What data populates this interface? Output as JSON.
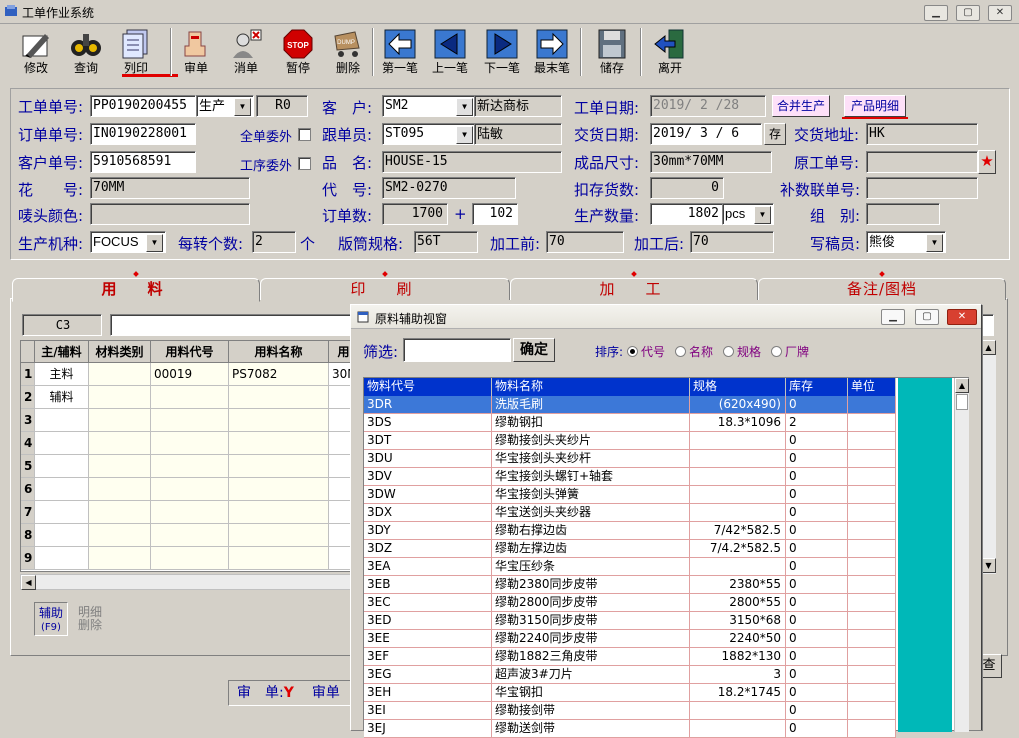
{
  "window": {
    "title": "工单作业系统"
  },
  "toolbar": [
    {
      "name": "edit",
      "label": "修改"
    },
    {
      "name": "query",
      "label": "查询"
    },
    {
      "name": "print",
      "label": "列印"
    },
    {
      "name": "review",
      "label": "审单"
    },
    {
      "name": "cancel-order",
      "label": "消单"
    },
    {
      "name": "pause",
      "label": "暂停"
    },
    {
      "name": "delete",
      "label": "删除"
    },
    {
      "name": "first",
      "label": "第一笔"
    },
    {
      "name": "prev",
      "label": "上一笔"
    },
    {
      "name": "next",
      "label": "下一笔"
    },
    {
      "name": "last",
      "label": "最末笔"
    },
    {
      "name": "save",
      "label": "储存"
    },
    {
      "name": "exit",
      "label": "离开"
    }
  ],
  "form": {
    "work_order_no_label": "工单单号:",
    "work_order_no": "PP0190200455",
    "type": "生产",
    "rev": "R0",
    "order_no_label": "订单单号:",
    "order_no": "IN0190228001",
    "all_outsource_label": "全单委外",
    "customer_no_label": "客户单号:",
    "customer_no": "5910568591",
    "process_outsource_label": "工序委外",
    "pattern_no_label": "花　　号:",
    "pattern_no": "70MM",
    "mouth_color_label": "唛头颜色:",
    "mouth_color": "",
    "machine_label": "生产机种:",
    "machine": "FOCUS",
    "per_turn_label": "每转个数:",
    "per_turn": "2",
    "per_turn_unit": "个",
    "customer_label": "客　户:",
    "customer": "SM2",
    "customer_name": "新达商标",
    "follow_label": "跟单员:",
    "follow": "ST095",
    "follow_name": "陆敏",
    "product_label": "品　名:",
    "product": "HOUSE-15",
    "code_label": "代　号:",
    "code": "SM2-0270",
    "order_qty_label": "订单数:",
    "order_qty": "1700",
    "plus": "+",
    "order_extra": "102",
    "cylinder_label": "版筒规格:",
    "cylinder": "56T",
    "pre_process_label": "加工前:",
    "pre_process": "70",
    "post_process_label": "加工后:",
    "post_process": "70",
    "wo_date_label": "工单日期:",
    "wo_date": "2019/ 2 /28",
    "merge_btn": "合并生产",
    "detail_btn": "产品明细",
    "delivery_date_label": "交货日期:",
    "delivery_date": "2019/ 3 / 6",
    "save_small": "存",
    "delivery_addr_label": "交货地址:",
    "delivery_addr": "HK",
    "size_label": "成品尺寸:",
    "size": "30mm*70MM",
    "original_no_label": "原工单号:",
    "original_no": "",
    "deduct_label": "扣存货数:",
    "deduct": "0",
    "supplement_label": "补数联单号:",
    "supplement": "",
    "prod_qty_label": "生产数量:",
    "prod_qty": "1802",
    "unit": "pcs",
    "group_label": "组　别:",
    "group": "",
    "writer_label": "写稿员:",
    "writer": "熊俊"
  },
  "tabs": [
    "用　料",
    "印　刷",
    "加　工",
    "备注/图档"
  ],
  "grid": {
    "cell_ref": "C3",
    "headers": [
      "主/辅料",
      "材料类别",
      "用料代号",
      "用料名称",
      "用"
    ],
    "rows": [
      {
        "n": "1",
        "a": "主料",
        "b": "",
        "c": "00019",
        "d": "PS7082",
        "e": "30M"
      },
      {
        "n": "2",
        "a": "辅料",
        "b": "",
        "c": "",
        "d": "",
        "e": ""
      },
      {
        "n": "3",
        "a": "",
        "b": "",
        "c": "",
        "d": "",
        "e": ""
      },
      {
        "n": "4",
        "a": "",
        "b": "",
        "c": "",
        "d": "",
        "e": ""
      },
      {
        "n": "5",
        "a": "",
        "b": "",
        "c": "",
        "d": "",
        "e": ""
      },
      {
        "n": "6",
        "a": "",
        "b": "",
        "c": "",
        "d": "",
        "e": ""
      },
      {
        "n": "7",
        "a": "",
        "b": "",
        "c": "",
        "d": "",
        "e": ""
      },
      {
        "n": "8",
        "a": "",
        "b": "",
        "c": "",
        "d": "",
        "e": ""
      },
      {
        "n": "9",
        "a": "",
        "b": "",
        "c": "",
        "d": "",
        "e": ""
      }
    ],
    "aux_btn_label": "辅助",
    "aux_btn_key": "(F9)",
    "detail_delete_1": "明细",
    "detail_delete_2": "删除"
  },
  "status": {
    "review_label": "审　单:",
    "review_value": "Y",
    "review_label2": "审单",
    "right_label": "查"
  },
  "dialog": {
    "title": "原料辅助视窗",
    "filter_label": "筛选:",
    "filter_value": "",
    "ok_btn": "确定",
    "sort_label": "排序:",
    "sort_options": [
      "代号",
      "名称",
      "规格",
      "厂牌"
    ],
    "columns": [
      "物料代号",
      "物料名称",
      "规格",
      "库存",
      "单位"
    ],
    "rows": [
      {
        "code": "3DR",
        "name": "洗版毛刷",
        "spec": "(620x490)",
        "stock": "0",
        "unit": ""
      },
      {
        "code": "3DS",
        "name": "缪勒钢扣",
        "spec": "18.3*1096",
        "stock": "2",
        "unit": ""
      },
      {
        "code": "3DT",
        "name": "缪勒接剑头夹纱片",
        "spec": "",
        "stock": "0",
        "unit": ""
      },
      {
        "code": "3DU",
        "name": "华宝接剑头夹纱杆",
        "spec": "",
        "stock": "0",
        "unit": ""
      },
      {
        "code": "3DV",
        "name": "华宝接剑头螺钉+轴套",
        "spec": "",
        "stock": "0",
        "unit": ""
      },
      {
        "code": "3DW",
        "name": "华宝接剑头弹簧",
        "spec": "",
        "stock": "0",
        "unit": ""
      },
      {
        "code": "3DX",
        "name": "华宝送剑头夹纱器",
        "spec": "",
        "stock": "0",
        "unit": ""
      },
      {
        "code": "3DY",
        "name": "缪勒右撑边齿",
        "spec": "7/42*582.5",
        "stock": "0",
        "unit": ""
      },
      {
        "code": "3DZ",
        "name": "缪勒左撑边齿",
        "spec": "7/4.2*582.5",
        "stock": "0",
        "unit": ""
      },
      {
        "code": "3EA",
        "name": "华宝压纱条",
        "spec": "",
        "stock": "0",
        "unit": ""
      },
      {
        "code": "3EB",
        "name": "缪勒2380同步皮带",
        "spec": "2380*55",
        "stock": "0",
        "unit": ""
      },
      {
        "code": "3EC",
        "name": "缪勒2800同步皮带",
        "spec": "2800*55",
        "stock": "0",
        "unit": ""
      },
      {
        "code": "3ED",
        "name": "缪勒3150同步皮带",
        "spec": "3150*68",
        "stock": "0",
        "unit": ""
      },
      {
        "code": "3EE",
        "name": "缪勒2240同步皮带",
        "spec": "2240*50",
        "stock": "0",
        "unit": ""
      },
      {
        "code": "3EF",
        "name": "缪勒1882三角皮带",
        "spec": "1882*130",
        "stock": "0",
        "unit": ""
      },
      {
        "code": "3EG",
        "name": "超声波3#刀片",
        "spec": "3",
        "stock": "0",
        "unit": ""
      },
      {
        "code": "3EH",
        "name": "华宝钢扣",
        "spec": "18.2*1745",
        "stock": "0",
        "unit": ""
      },
      {
        "code": "3EI",
        "name": "缪勒接剑带",
        "spec": "",
        "stock": "0",
        "unit": ""
      },
      {
        "code": "3EJ",
        "name": "缪勒送剑带",
        "spec": "",
        "stock": "0",
        "unit": ""
      }
    ]
  }
}
